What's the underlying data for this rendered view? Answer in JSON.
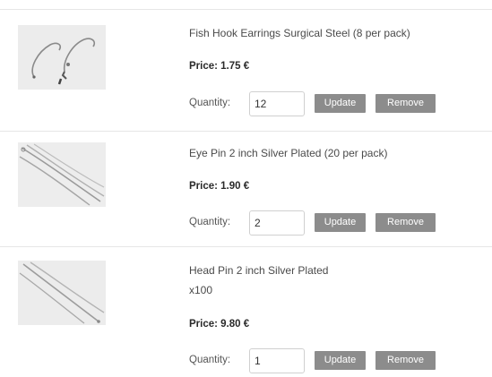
{
  "cart": {
    "quantity_label": "Quantity:",
    "update_label": "Update",
    "remove_label": "Remove",
    "items": [
      {
        "title": "Fish Hook Earrings Surgical Steel (8 per pack)",
        "title_line2": "",
        "price": "Price: 1.75 €",
        "quantity": "12",
        "image_icon": "fish-hook-earring-icon"
      },
      {
        "title": "Eye Pin 2 inch Silver Plated (20 per pack)",
        "title_line2": "",
        "price": "Price: 1.90 €",
        "quantity": "2",
        "image_icon": "eye-pin-icon"
      },
      {
        "title": "Head Pin 2 inch Silver Plated",
        "title_line2": "x100",
        "price": "Price: 9.80 €",
        "quantity": "1",
        "image_icon": "head-pin-icon"
      }
    ]
  },
  "colors": {
    "button_bg": "#8c8c8c",
    "button_text": "#ffffff",
    "divider": "#e6e6e6"
  }
}
